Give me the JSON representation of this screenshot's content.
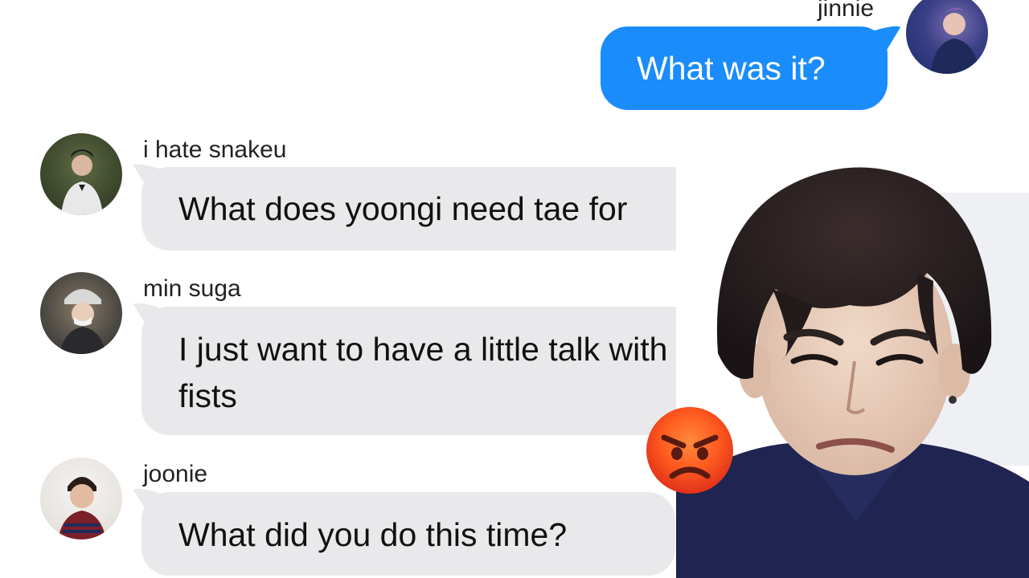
{
  "messages": [
    {
      "sender": "jinnie",
      "text": "What was it?",
      "direction": "outgoing"
    },
    {
      "sender": "i hate snakeu",
      "text": "What does yoongi need tae for",
      "direction": "incoming"
    },
    {
      "sender": "min suga",
      "text": "I just want to have a little talk with my fists",
      "direction": "incoming"
    },
    {
      "sender": "joonie",
      "text": "What did you do this time?",
      "direction": "incoming"
    }
  ],
  "reaction": {
    "emoji": "angry-face",
    "photo": "frowning-person"
  },
  "colors": {
    "outgoing_bubble": "#1a8cfb",
    "incoming_bubble": "#e9e9eb",
    "background": "#ffffff"
  }
}
